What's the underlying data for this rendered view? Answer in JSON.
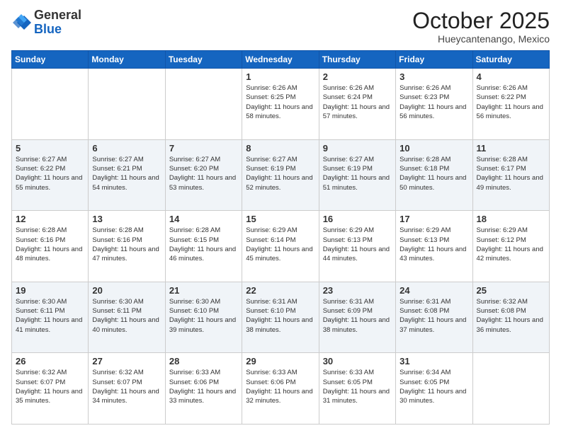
{
  "header": {
    "logo": {
      "general": "General",
      "blue": "Blue"
    },
    "month": "October 2025",
    "location": "Hueycantenango, Mexico"
  },
  "days_of_week": [
    "Sunday",
    "Monday",
    "Tuesday",
    "Wednesday",
    "Thursday",
    "Friday",
    "Saturday"
  ],
  "weeks": [
    [
      {
        "day": "",
        "info": ""
      },
      {
        "day": "",
        "info": ""
      },
      {
        "day": "",
        "info": ""
      },
      {
        "day": "1",
        "info": "Sunrise: 6:26 AM\nSunset: 6:25 PM\nDaylight: 11 hours and 58 minutes."
      },
      {
        "day": "2",
        "info": "Sunrise: 6:26 AM\nSunset: 6:24 PM\nDaylight: 11 hours and 57 minutes."
      },
      {
        "day": "3",
        "info": "Sunrise: 6:26 AM\nSunset: 6:23 PM\nDaylight: 11 hours and 56 minutes."
      },
      {
        "day": "4",
        "info": "Sunrise: 6:26 AM\nSunset: 6:22 PM\nDaylight: 11 hours and 56 minutes."
      }
    ],
    [
      {
        "day": "5",
        "info": "Sunrise: 6:27 AM\nSunset: 6:22 PM\nDaylight: 11 hours and 55 minutes."
      },
      {
        "day": "6",
        "info": "Sunrise: 6:27 AM\nSunset: 6:21 PM\nDaylight: 11 hours and 54 minutes."
      },
      {
        "day": "7",
        "info": "Sunrise: 6:27 AM\nSunset: 6:20 PM\nDaylight: 11 hours and 53 minutes."
      },
      {
        "day": "8",
        "info": "Sunrise: 6:27 AM\nSunset: 6:19 PM\nDaylight: 11 hours and 52 minutes."
      },
      {
        "day": "9",
        "info": "Sunrise: 6:27 AM\nSunset: 6:19 PM\nDaylight: 11 hours and 51 minutes."
      },
      {
        "day": "10",
        "info": "Sunrise: 6:28 AM\nSunset: 6:18 PM\nDaylight: 11 hours and 50 minutes."
      },
      {
        "day": "11",
        "info": "Sunrise: 6:28 AM\nSunset: 6:17 PM\nDaylight: 11 hours and 49 minutes."
      }
    ],
    [
      {
        "day": "12",
        "info": "Sunrise: 6:28 AM\nSunset: 6:16 PM\nDaylight: 11 hours and 48 minutes."
      },
      {
        "day": "13",
        "info": "Sunrise: 6:28 AM\nSunset: 6:16 PM\nDaylight: 11 hours and 47 minutes."
      },
      {
        "day": "14",
        "info": "Sunrise: 6:28 AM\nSunset: 6:15 PM\nDaylight: 11 hours and 46 minutes."
      },
      {
        "day": "15",
        "info": "Sunrise: 6:29 AM\nSunset: 6:14 PM\nDaylight: 11 hours and 45 minutes."
      },
      {
        "day": "16",
        "info": "Sunrise: 6:29 AM\nSunset: 6:13 PM\nDaylight: 11 hours and 44 minutes."
      },
      {
        "day": "17",
        "info": "Sunrise: 6:29 AM\nSunset: 6:13 PM\nDaylight: 11 hours and 43 minutes."
      },
      {
        "day": "18",
        "info": "Sunrise: 6:29 AM\nSunset: 6:12 PM\nDaylight: 11 hours and 42 minutes."
      }
    ],
    [
      {
        "day": "19",
        "info": "Sunrise: 6:30 AM\nSunset: 6:11 PM\nDaylight: 11 hours and 41 minutes."
      },
      {
        "day": "20",
        "info": "Sunrise: 6:30 AM\nSunset: 6:11 PM\nDaylight: 11 hours and 40 minutes."
      },
      {
        "day": "21",
        "info": "Sunrise: 6:30 AM\nSunset: 6:10 PM\nDaylight: 11 hours and 39 minutes."
      },
      {
        "day": "22",
        "info": "Sunrise: 6:31 AM\nSunset: 6:10 PM\nDaylight: 11 hours and 38 minutes."
      },
      {
        "day": "23",
        "info": "Sunrise: 6:31 AM\nSunset: 6:09 PM\nDaylight: 11 hours and 38 minutes."
      },
      {
        "day": "24",
        "info": "Sunrise: 6:31 AM\nSunset: 6:08 PM\nDaylight: 11 hours and 37 minutes."
      },
      {
        "day": "25",
        "info": "Sunrise: 6:32 AM\nSunset: 6:08 PM\nDaylight: 11 hours and 36 minutes."
      }
    ],
    [
      {
        "day": "26",
        "info": "Sunrise: 6:32 AM\nSunset: 6:07 PM\nDaylight: 11 hours and 35 minutes."
      },
      {
        "day": "27",
        "info": "Sunrise: 6:32 AM\nSunset: 6:07 PM\nDaylight: 11 hours and 34 minutes."
      },
      {
        "day": "28",
        "info": "Sunrise: 6:33 AM\nSunset: 6:06 PM\nDaylight: 11 hours and 33 minutes."
      },
      {
        "day": "29",
        "info": "Sunrise: 6:33 AM\nSunset: 6:06 PM\nDaylight: 11 hours and 32 minutes."
      },
      {
        "day": "30",
        "info": "Sunrise: 6:33 AM\nSunset: 6:05 PM\nDaylight: 11 hours and 31 minutes."
      },
      {
        "day": "31",
        "info": "Sunrise: 6:34 AM\nSunset: 6:05 PM\nDaylight: 11 hours and 30 minutes."
      },
      {
        "day": "",
        "info": ""
      }
    ]
  ]
}
